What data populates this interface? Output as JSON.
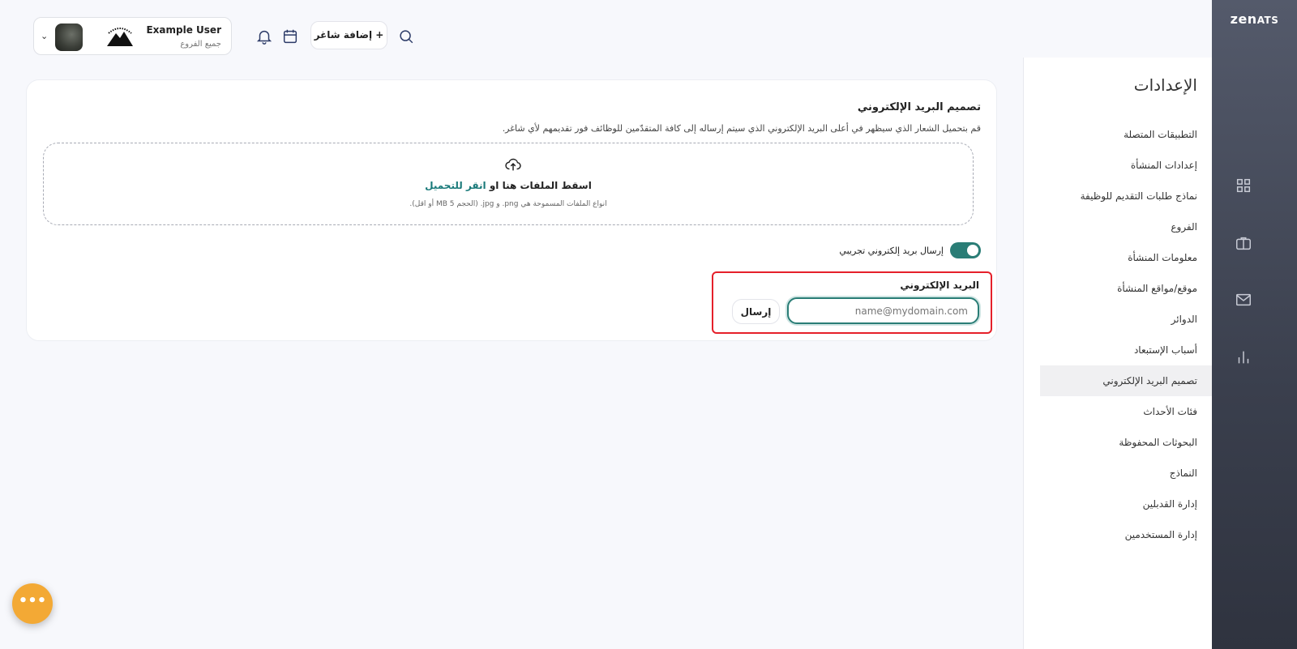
{
  "brand": {
    "logo_main": "zen",
    "logo_accent": "ATS"
  },
  "rail": {
    "icons": [
      "grid-icon",
      "briefcase-icon",
      "mail-icon",
      "chart-icon"
    ]
  },
  "settings": {
    "title": "الإعدادات",
    "items": [
      "التطبيقات المتصلة",
      "إعدادات المنشأة",
      "نماذج طلبات التقديم للوظيفة",
      "الفروع",
      "معلومات المنشأة",
      "موقع/مواقع المنشأة",
      "الدوائر",
      "أسباب الإستبعاد",
      "تصميم البريد الإلكتروني",
      "فئات الأحداث",
      "البحوثات المحفوظة",
      "النماذج",
      "إدارة القدبلين",
      "إدارة المستخدمين"
    ],
    "active_index": 8
  },
  "header": {
    "user_name": "Example User",
    "user_branch": "جميع الفروع",
    "add_button": "+ إضافة شاغر"
  },
  "email_design": {
    "title": "تصميم البريد الإلكتروني",
    "description": "قم بتحميل الشعار الذي سيظهر في أعلى البريد الإلكتروني الذي سيتم إرساله إلى كافة المتقدّمين للوظائف فور تقديمهم لأي شاغر.",
    "drop_text": "اسقط الملفات هنا او ",
    "drop_link": "انقر للتحميل",
    "drop_hint": "انواع الملفات المسموحة هي png. و jpg. (الحجم 5 MB أو اقل).",
    "test_toggle_label": "إرسال بريد إلكتروني تجريبي",
    "test_toggle_on": true,
    "email_label": "البريد الإلكتروني",
    "email_placeholder": "name@mydomain.com",
    "send_button": "إرسال"
  },
  "fab_label": "•••",
  "colors": {
    "accent": "#2a7d76",
    "fab": "#f3a935",
    "highlight": "#e5202a",
    "rail": "#3a3f4d"
  }
}
